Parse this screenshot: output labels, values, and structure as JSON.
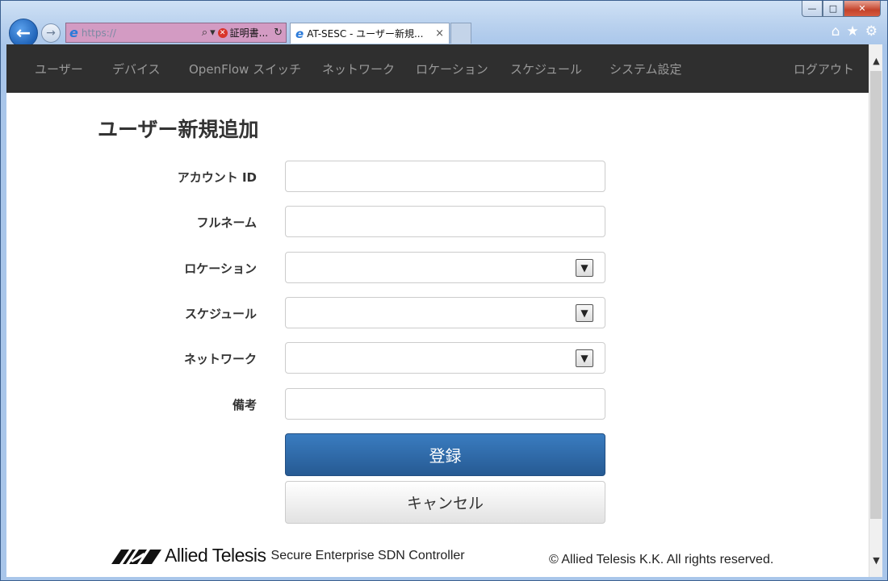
{
  "browser": {
    "address_url": "https://",
    "cert_error_label": "証明書...",
    "tab_title": "AT-SESC - ユーザー新規...",
    "tab_close": "×",
    "window_controls": {
      "min": "—",
      "max": "□",
      "close": "✕"
    }
  },
  "navbar": {
    "items": [
      "ユーザー",
      "デバイス",
      "OpenFlow スイッチ",
      "ネットワーク",
      "ロケーション",
      "スケジュール",
      "システム設定"
    ],
    "logout": "ログアウト"
  },
  "page": {
    "title": "ユーザー新規追加"
  },
  "form": {
    "account_id": {
      "label": "アカウント ID",
      "value": ""
    },
    "full_name": {
      "label": "フルネーム",
      "value": ""
    },
    "location": {
      "label": "ロケーション",
      "value": ""
    },
    "schedule": {
      "label": "スケジュール",
      "value": ""
    },
    "network": {
      "label": "ネットワーク",
      "value": ""
    },
    "notes": {
      "label": "備考",
      "value": ""
    },
    "submit_label": "登録",
    "cancel_label": "キャンセル"
  },
  "footer": {
    "brand": "Allied Telesis",
    "product": "Secure Enterprise SDN Controller",
    "copyright": "© Allied Telesis K.K. All rights reserved."
  },
  "colors": {
    "navbar_bg": "#2f2f2f",
    "primary_button": "#2f6ca8"
  }
}
